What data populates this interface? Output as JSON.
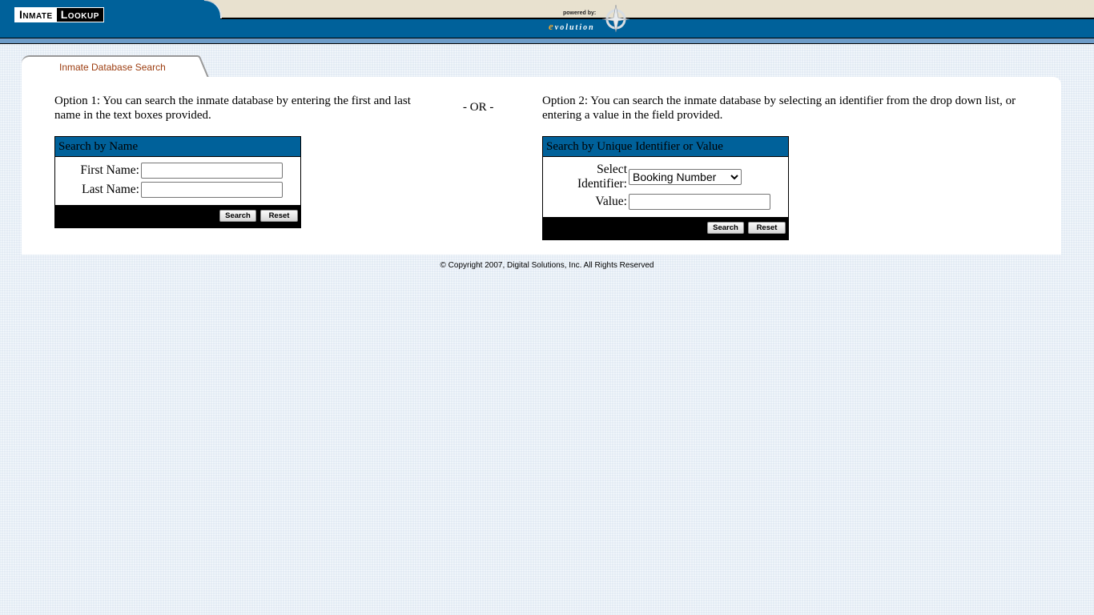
{
  "header": {
    "logo_part1": "Inmate",
    "logo_part2": "Lookup",
    "powered_by": "powered by:",
    "brand_e": "e",
    "brand_rest": "volution"
  },
  "tab": {
    "label": "Inmate Database Search"
  },
  "option1": {
    "text": "Option 1: You can search the inmate database by entering the first and last name in the text boxes provided.",
    "box_title": "Search by Name",
    "first_name_label": "First Name:",
    "first_name_value": "",
    "last_name_label": "Last Name:",
    "last_name_value": "",
    "search_label": "Search",
    "reset_label": "Reset"
  },
  "separator": "- OR -",
  "option2": {
    "text": "Option 2: You can search the inmate database by selecting an identifier from the drop down list, or entering a value in the field provided.",
    "box_title": "Search by Unique Identifier or Value",
    "identifier_label_line1": "Select",
    "identifier_label_line2": "Identifier:",
    "identifier_selected": "Booking Number",
    "value_label": "Value:",
    "value_value": "",
    "search_label": "Search",
    "reset_label": "Reset"
  },
  "footer": {
    "copyright": "© Copyright 2007, Digital Solutions, Inc. All Rights Reserved"
  }
}
